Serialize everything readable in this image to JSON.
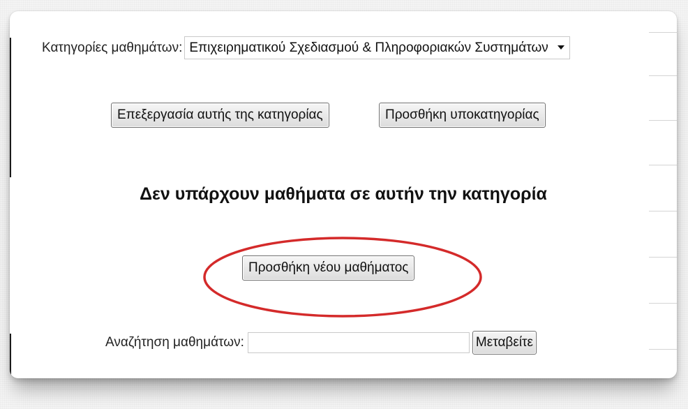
{
  "category": {
    "label": "Κατηγορίες μαθημάτων:",
    "selected": "Επιχειρηματικού Σχεδιασμού & Πληροφοριακών Συστημάτων"
  },
  "actions": {
    "edit_category": "Επεξεργασία αυτής της κατηγορίας",
    "add_subcategory": "Προσθήκη υποκατηγορίας"
  },
  "empty_message": "Δεν υπάρχουν μαθήματα σε αυτήν την κατηγορία",
  "add_course": "Προσθήκη νέου μαθήματος",
  "search": {
    "label": "Αναζήτηση μαθημάτων:",
    "value": "",
    "button": "Μεταβείτε"
  },
  "colors": {
    "highlight": "#d42a2a",
    "button_border": "#707070"
  }
}
